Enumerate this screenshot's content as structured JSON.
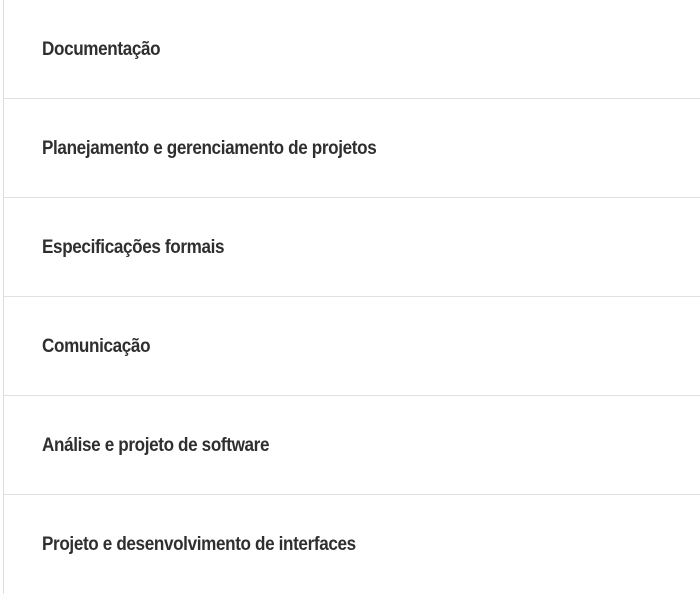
{
  "items": [
    {
      "label": "Documentação"
    },
    {
      "label": "Planejamento e gerenciamento de projetos"
    },
    {
      "label": "Especificações formais"
    },
    {
      "label": "Comunicação"
    },
    {
      "label": "Análise e projeto de software"
    },
    {
      "label": "Projeto e desenvolvimento de interfaces"
    }
  ]
}
